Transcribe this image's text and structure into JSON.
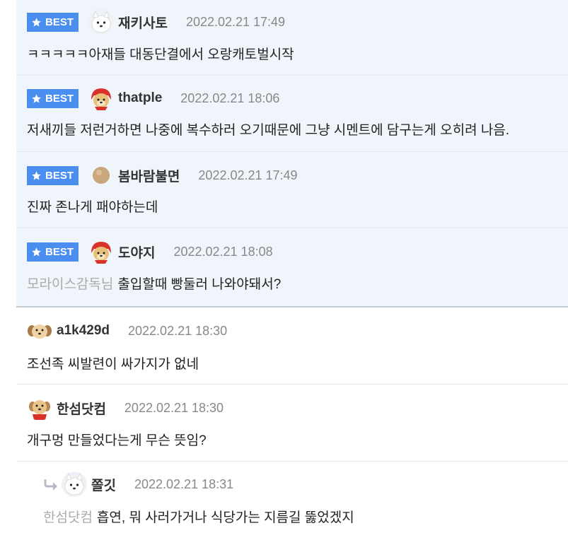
{
  "badge_label": "BEST",
  "best_comments": [
    {
      "nick": "재키사토",
      "date": "2022.02.21 17:49",
      "text": "ㅋㅋㅋㅋㅋ아재들 대동단결에서 오랑캐토벌시작",
      "avatar": "white-dog-avatar"
    },
    {
      "nick": "thatple",
      "date": "2022.02.21 18:06",
      "text": "저새끼들 저런거하면 나중에 복수하러 오기때문에 그냥 시멘트에 담구는게 오히려 나음.",
      "avatar": "red-hood-puppy-avatar"
    },
    {
      "nick": "봄바람불면",
      "date": "2022.02.21 17:49",
      "text": "진짜 존나게 패야하는데",
      "avatar": "beige-dot-avatar"
    },
    {
      "nick": "도야지",
      "date": "2022.02.21 18:08",
      "mention": "모라이스감독님",
      "text": "출입할때 빵둘러 나와야돼서?",
      "avatar": "red-hood-puppy-avatar"
    }
  ],
  "comments": [
    {
      "nick": "a1k429d",
      "date": "2022.02.21 18:30",
      "text": "조선족 씨발련이 싸가지가 없네",
      "avatar": "puppy-face-avatar"
    },
    {
      "nick": "한섬닷컴",
      "date": "2022.02.21 18:30",
      "text": "개구멍 만들었다는게 무슨 뜻임?",
      "avatar": "red-scarf-puppy-avatar"
    }
  ],
  "reply": {
    "nick": "쫄깃",
    "date": "2022.02.21 18:31",
    "mention": "한섬닷컴",
    "text": "흡연, 뭐 사러가거나 식당가는 지름길 뚫었겠지",
    "avatar": "white-dog-avatar"
  },
  "colors": {
    "badge": "#4a8ef0",
    "best_bg": "#f0f4fb",
    "date": "#888888",
    "mention": "#aaaaaa"
  }
}
